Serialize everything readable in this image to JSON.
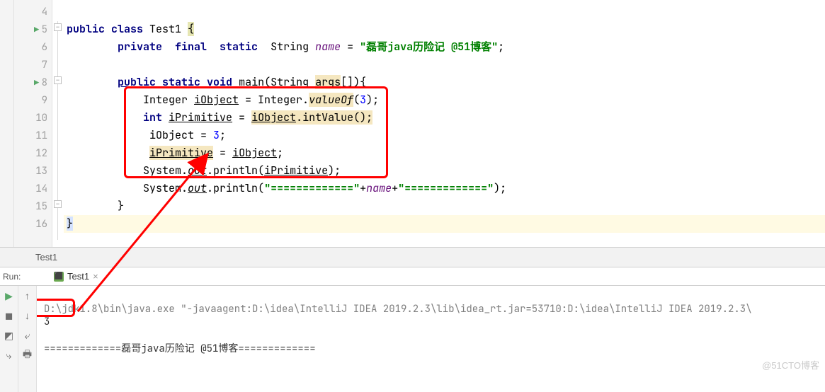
{
  "gutter": {
    "lines": [
      "4",
      "5",
      "6",
      "7",
      "8",
      "9",
      "10",
      "11",
      "12",
      "13",
      "14",
      "15",
      "16"
    ],
    "runnable": [
      1,
      4
    ]
  },
  "code": {
    "l4": "",
    "l5_public": "public ",
    "l5_class": "class ",
    "l5_name": "Test1 ",
    "l5_brace": "{",
    "l6_priv": "private  ",
    "l6_final": "final  ",
    "l6_static": "static  ",
    "l6_type": "String ",
    "l6_var": "name",
    "l6_eq": " = ",
    "l6_str": "\"磊哥java历险记 @51博客\"",
    "l6_semi": ";",
    "l8_pub": "public ",
    "l8_static": "static ",
    "l8_void": "void ",
    "l8_main": "main",
    "l8_p1": "(String ",
    "l8_args": "args",
    "l8_p2": "[]){",
    "l9_a": "Integer ",
    "l9_b": "iObject",
    "l9_c": " = Integer.",
    "l9_d": "valueOf",
    "l9_e": "(",
    "l9_f": "3",
    "l9_g": ");",
    "l10_a": "int ",
    "l10_b": "iPrimitive",
    "l10_c": " = ",
    "l10_d": "iObject",
    "l10_e": ".intValue();",
    "l11_a": " iObject = ",
    "l11_b": "3",
    "l11_c": ";",
    "l12_a": " ",
    "l12_b": "iPrimitive",
    "l12_c": " = ",
    "l12_d": "iObject",
    "l12_e": ";",
    "l13_a": "System.",
    "l13_b": "out",
    "l13_c": ".println(",
    "l13_d": "iPrimitive",
    "l13_e": ");",
    "l14_a": "System.",
    "l14_b": "out",
    "l14_c": ".println(",
    "l14_d": "\"=============\"",
    "l14_e": "+",
    "l14_f": "name",
    "l14_g": "+",
    "l14_h": "\"=============\"",
    "l14_i": ");",
    "l15": "}",
    "l16": "}"
  },
  "tab": {
    "name": "Test1"
  },
  "run": {
    "label": "Run:",
    "tab": "Test1",
    "cmd": "D:\\jdk1.8\\bin\\java.exe \"-javaagent:D:\\idea\\IntelliJ IDEA 2019.2.3\\lib\\idea_rt.jar=53710:D:\\idea\\IntelliJ IDEA 2019.2.3\\",
    "out1": "3",
    "out2": "=============磊哥java历险记 @51博客============="
  },
  "watermark": "@51CTO博客"
}
